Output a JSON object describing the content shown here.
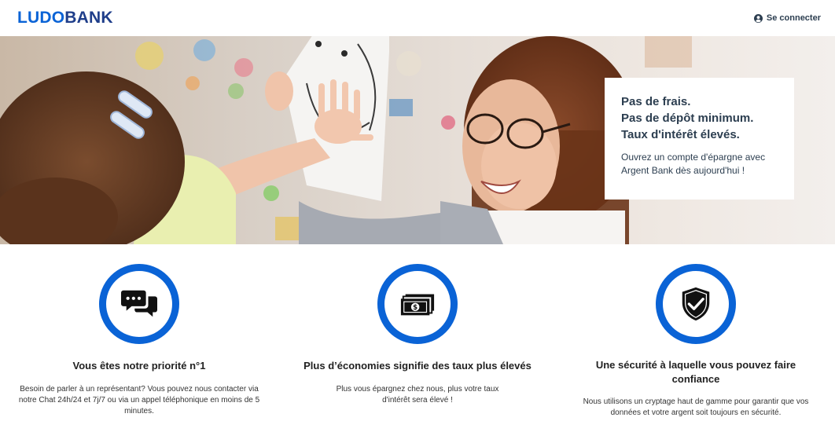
{
  "header": {
    "logo_part1": "LUDO",
    "logo_part2": "BANK",
    "signin_label": "Se connecter",
    "signin_icon": "user-circle-icon"
  },
  "hero": {
    "image_description_icon": "hero-photo",
    "promo": {
      "subtitles": [
        "Pas de frais.",
        "Pas de dépôt minimum.",
        "Taux d'intérêt élevés."
      ],
      "text": "Ouvrez un compte d'épargne avec Argent Bank dès aujourd'hui !"
    }
  },
  "features": [
    {
      "icon": "chat-icon",
      "title": "Vous êtes notre priorité n°1",
      "text": "Besoin de parler à un représentant? Vous pouvez nous contacter via notre Chat 24h/24 et 7j/7 ou via un appel téléphonique en moins de 5 minutes."
    },
    {
      "icon": "money-icon",
      "title": "Plus d’économies signifie des taux plus élevés",
      "text": "Plus vous épargnez chez nous, plus votre taux d'intérêt sera élevé !"
    },
    {
      "icon": "security-shield-icon",
      "title": "Une sécurité à laquelle vous pouvez faire confiance",
      "text": "Nous utilisons un cryptage haut de gamme pour garantir que vos données et votre argent soit toujours en sécurité."
    }
  ],
  "colors": {
    "accent": "#0a63d6",
    "logo_dark": "#1f3e8a",
    "text": "#2c3e50"
  }
}
